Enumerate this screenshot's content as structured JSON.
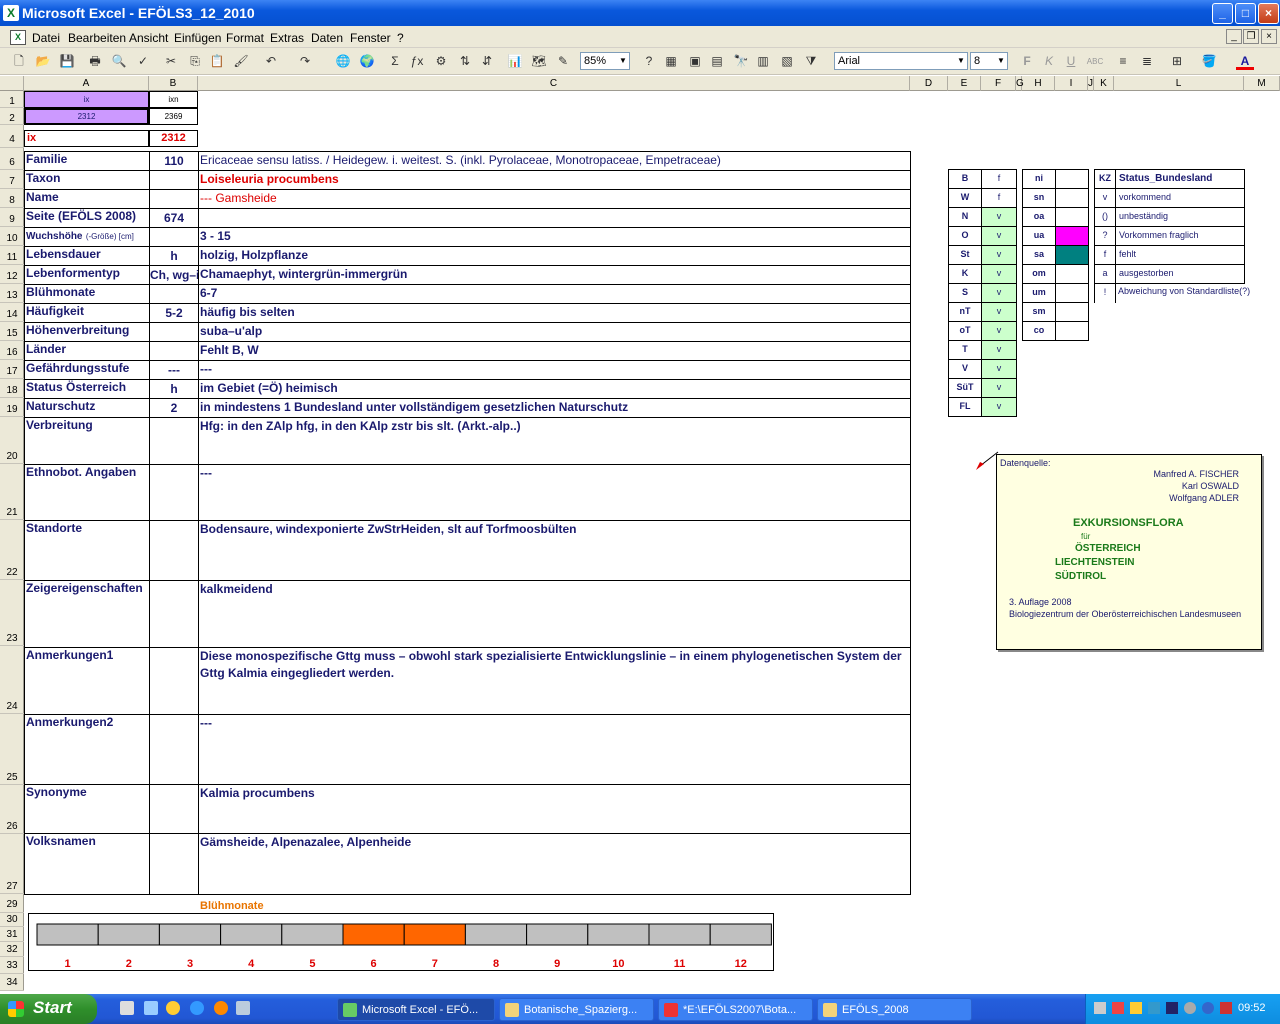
{
  "app": {
    "title": "Microsoft Excel - EFÖLS3_12_2010",
    "logo": "X"
  },
  "window_buttons": {
    "min": "_",
    "max": "□",
    "close": "×"
  },
  "menu": [
    "Datei",
    "Bearbeiten",
    "Ansicht",
    "Einfügen",
    "Format",
    "Extras",
    "Daten",
    "Fenster",
    "?"
  ],
  "toolbar": {
    "zoom": "85%",
    "font": "Arial",
    "size": "8",
    "bold": "F",
    "italic": "K",
    "underline": "U"
  },
  "columns": [
    "A",
    "B",
    "C",
    "D",
    "E",
    "F",
    "G",
    "H",
    "I",
    "J",
    "K",
    "L",
    "M"
  ],
  "rows": [
    "1",
    "2",
    "4",
    "6",
    "7",
    "8",
    "9",
    "10",
    "11",
    "12",
    "13",
    "14",
    "15",
    "16",
    "17",
    "18",
    "19",
    "20",
    "21",
    "22",
    "23",
    "24",
    "25",
    "26",
    "27",
    "29",
    "30",
    "31",
    "32",
    "33",
    "34"
  ],
  "top": {
    "a1": "ix",
    "b1": "ixn",
    "a2": "2312",
    "b2": "2369"
  },
  "row4": {
    "label": "ix",
    "value": "2312"
  },
  "fields": [
    {
      "label": "Familie",
      "b": "110",
      "c": "Ericaceae sensu latiss.  /  Heidegew. i. weitest. S. (inkl. Pyrolaceae, Monotropaceae, Empetraceae)"
    },
    {
      "label": "Taxon",
      "b": "",
      "c": "Loiseleuria procumbens"
    },
    {
      "label": "Name",
      "b": "",
      "c": " --- Gamsheide"
    },
    {
      "label": "Seite (EFÖLS 2008)",
      "b": "674",
      "c": ""
    },
    {
      "label": "Wuchshöhe",
      "sub": "(-Größe) [cm]",
      "b": "",
      "c": " 3 - 15"
    },
    {
      "label": "Lebensdauer",
      "b": "h",
      "c": "holzig, Holzpflanze"
    },
    {
      "label": "Lebenformentyp",
      "b": "Ch, wg–ig",
      "c": "Chamaephyt, wintergrün-immergrün"
    },
    {
      "label": "Blühmonate",
      "b": "",
      "c": " 6-7"
    },
    {
      "label": "Häufigkeit",
      "b": "5-2",
      "c": "häufig bis selten"
    },
    {
      "label": "Höhenverbreitung",
      "b": "",
      "c": "suba–u'alp"
    },
    {
      "label": "Länder",
      "b": "",
      "c": "Fehlt B, W"
    },
    {
      "label": "Gefährdungsstufe",
      "b": "---",
      "c": "  ---"
    },
    {
      "label": "Status Österreich",
      "b": "h",
      "c": "im Gebiet (=Ö) heimisch"
    },
    {
      "label": "Naturschutz",
      "b": "2",
      "c": "in mindestens 1 Bundesland unter vollständigem gesetzlichen Naturschutz"
    },
    {
      "label": "Verbreitung",
      "b": "",
      "c": "Hfg: in den ZAlp hfg, in den KAlp zstr bis slt. (Arkt.-alp..)"
    },
    {
      "label": "Ethnobot. Angaben",
      "b": "",
      "c": "---"
    },
    {
      "label": "Standorte",
      "b": "",
      "c": "Bodensaure, windexponierte ZwStrHeiden, slt auf Torfmoosbülten"
    },
    {
      "label": "Zeigereigenschaften",
      "b": "",
      "c": "kalkmeidend"
    },
    {
      "label": "Anmerkungen1",
      "b": "",
      "c": "Diese monospezifische Gttg muss – obwohl stark spezialisierte Entwicklungslinie – in einem phylogenetischen System der",
      "c2": "Gttg Kalmia eingegliedert werden."
    },
    {
      "label": "Anmerkungen2",
      "b": "",
      "c": "---"
    },
    {
      "label": "Synonyme",
      "b": "",
      "c": "Kalmia procumbens"
    },
    {
      "label": "Volksnamen",
      "b": "",
      "c": "Gämsheide, Alpenazalee, Alpenheide"
    }
  ],
  "laender": {
    "header": [
      "B",
      "f"
    ],
    "rows": [
      [
        "W",
        "f"
      ],
      [
        "N",
        "v"
      ],
      [
        "O",
        "v"
      ],
      [
        "St",
        "v"
      ],
      [
        "K",
        "v"
      ],
      [
        "S",
        "v"
      ],
      [
        "nT",
        "v"
      ],
      [
        "oT",
        "v"
      ],
      [
        "T",
        "v"
      ],
      [
        "V",
        "v"
      ],
      [
        "SüT",
        "v"
      ],
      [
        "FL",
        "v"
      ]
    ]
  },
  "hoehen": [
    "ni",
    "sn",
    "oa",
    "ua",
    "sa",
    "om",
    "um",
    "sm",
    "co"
  ],
  "kz": {
    "header": [
      "KZ",
      "Status_Bundesland"
    ],
    "rows": [
      [
        "v",
        "vorkommend"
      ],
      [
        "()",
        "unbeständig"
      ],
      [
        "?",
        "Vorkommen fraglich"
      ],
      [
        "f",
        "fehlt"
      ],
      [
        "a",
        "ausgestorben"
      ],
      [
        "!",
        "Abweichung von Standardliste(?)"
      ]
    ]
  },
  "bloom": {
    "title": "Blühmonate",
    "months": [
      "1",
      "2",
      "3",
      "4",
      "5",
      "6",
      "7",
      "8",
      "9",
      "10",
      "11",
      "12"
    ],
    "active": [
      6,
      7
    ],
    "active_color": "#ff6600",
    "inactive_color": "#c0c0c0"
  },
  "note": {
    "label": "Datenquelle:",
    "authors": [
      "Manfred A. FISCHER",
      "Karl OSWALD",
      "Wolfgang ADLER"
    ],
    "title": "EXKURSIONSFLORA",
    "fuer": "für",
    "countries": [
      "ÖSTERREICH",
      "LIECHTENSTEIN",
      "SÜDTIROL"
    ],
    "edition": "3. Auflage 2008",
    "publisher": "Biologiezentrum der Oberösterreichischen Landesmuseen"
  },
  "taskbar": {
    "start": "Start",
    "tasks": [
      "Microsoft Excel - EFÖ...",
      "Botanische_Spazierg...",
      "*E:\\EFÖLS2007\\Bota...",
      "EFÖLS_2008"
    ],
    "clock": "09:52"
  }
}
